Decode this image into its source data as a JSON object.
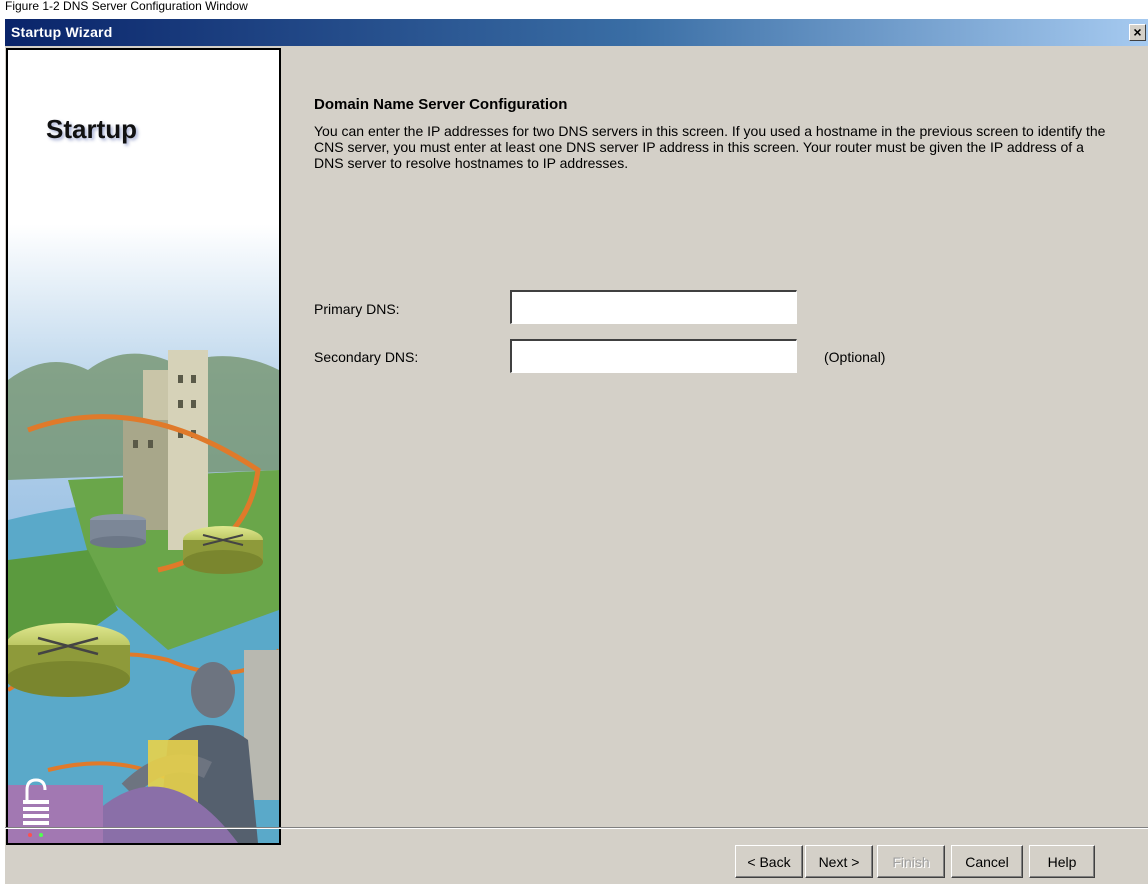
{
  "caption": "Figure 1-2 DNS Server Configuration Window",
  "window": {
    "title": "Startup Wizard",
    "close_glyph": "×"
  },
  "side_panel": {
    "title": "Startup",
    "lock_icon": "lock-icon"
  },
  "main": {
    "heading": "Domain Name Server Configuration",
    "description": "You can enter the IP addresses for two DNS servers in this screen. If you used a hostname in the previous screen to identify the CNS server, you must enter at least one DNS server IP address in this screen. Your router must be given the IP address of a DNS server to resolve hostnames to IP addresses.",
    "primary_dns": {
      "label": "Primary DNS:",
      "value": "",
      "placeholder": ""
    },
    "secondary_dns": {
      "label": "Secondary DNS:",
      "value": "",
      "placeholder": "",
      "note": "(Optional)"
    }
  },
  "buttons": {
    "back": "< Back",
    "next": "Next >",
    "finish": "Finish",
    "cancel": "Cancel",
    "help": "Help"
  },
  "colors": {
    "titlebar_start": "#0a246a",
    "titlebar_end": "#a6caf0",
    "dialog_bg": "#d4d0c8"
  }
}
